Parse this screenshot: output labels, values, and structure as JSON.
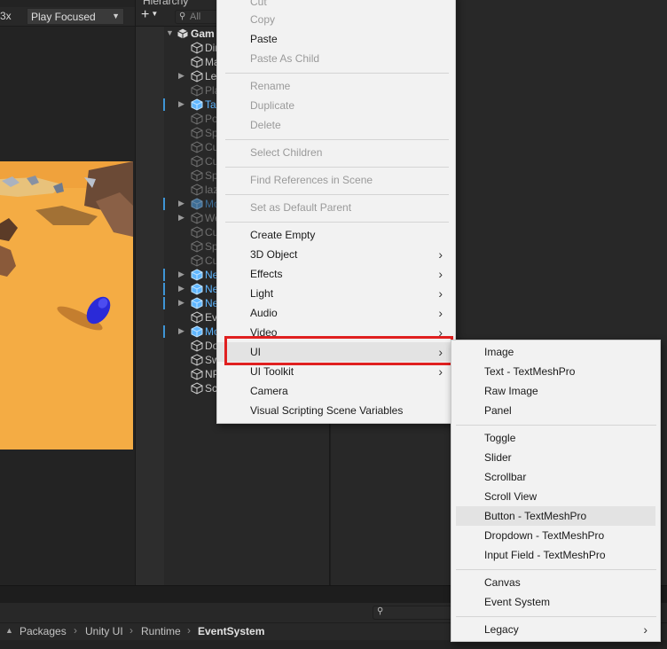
{
  "game_toolbar": {
    "scale": "3x",
    "play_mode": "Play Focused"
  },
  "hierarchy": {
    "tab": "Hierarchy",
    "search_placeholder": "All",
    "root": "Gam",
    "items": [
      {
        "name": "Dir",
        "style": "normal"
      },
      {
        "name": "Ma",
        "style": "normal"
      },
      {
        "name": "Le",
        "style": "normal"
      },
      {
        "name": "Pla",
        "style": "dim"
      },
      {
        "name": "Ta",
        "style": "prefab"
      },
      {
        "name": "Po",
        "style": "dim"
      },
      {
        "name": "Sp",
        "style": "dim"
      },
      {
        "name": "Cu",
        "style": "dim"
      },
      {
        "name": "Cu",
        "style": "dim"
      },
      {
        "name": "Sp",
        "style": "dim"
      },
      {
        "name": "laz",
        "style": "dim"
      },
      {
        "name": "Mo",
        "style": "prefab-dim"
      },
      {
        "name": "We",
        "style": "dim"
      },
      {
        "name": "Cu",
        "style": "dim"
      },
      {
        "name": "Sp",
        "style": "dim"
      },
      {
        "name": "Cu",
        "style": "dim"
      },
      {
        "name": "Ne",
        "style": "prefab"
      },
      {
        "name": "Ne",
        "style": "prefab"
      },
      {
        "name": "Ne",
        "style": "prefab"
      },
      {
        "name": "Eve",
        "style": "normal"
      },
      {
        "name": "Mo",
        "style": "prefab"
      },
      {
        "name": "Do",
        "style": "normal"
      },
      {
        "name": "Sw",
        "style": "normal"
      },
      {
        "name": "NP",
        "style": "normal"
      },
      {
        "name": "Sc",
        "style": "normal"
      }
    ]
  },
  "context_menu": {
    "items": [
      {
        "label": "Cut",
        "disabled": true
      },
      {
        "label": "Copy",
        "disabled": true
      },
      {
        "label": "Paste",
        "disabled": false
      },
      {
        "label": "Paste As Child",
        "disabled": true
      },
      {
        "label": "Rename",
        "disabled": true
      },
      {
        "label": "Duplicate",
        "disabled": true
      },
      {
        "label": "Delete",
        "disabled": true
      },
      {
        "label": "Select Children",
        "disabled": true
      },
      {
        "label": "Find References in Scene",
        "disabled": true
      },
      {
        "label": "Set as Default Parent",
        "disabled": true
      },
      {
        "label": "Create Empty",
        "disabled": false
      },
      {
        "label": "3D Object",
        "disabled": false
      },
      {
        "label": "Effects",
        "disabled": false
      },
      {
        "label": "Light",
        "disabled": false
      },
      {
        "label": "Audio",
        "disabled": false
      },
      {
        "label": "Video",
        "disabled": false
      },
      {
        "label": "UI",
        "disabled": false
      },
      {
        "label": "UI Toolkit",
        "disabled": false
      },
      {
        "label": "Camera",
        "disabled": false
      },
      {
        "label": "Visual Scripting Scene Variables",
        "disabled": false
      }
    ]
  },
  "ui_submenu": {
    "items": [
      {
        "label": "Image"
      },
      {
        "label": "Text - TextMeshPro"
      },
      {
        "label": "Raw Image"
      },
      {
        "label": "Panel"
      },
      {
        "label": "Toggle"
      },
      {
        "label": "Slider"
      },
      {
        "label": "Scrollbar"
      },
      {
        "label": "Scroll View"
      },
      {
        "label": "Button - TextMeshPro"
      },
      {
        "label": "Dropdown - TextMeshPro"
      },
      {
        "label": "Input Field - TextMeshPro"
      },
      {
        "label": "Canvas"
      },
      {
        "label": "Event System"
      },
      {
        "label": "Legacy"
      }
    ]
  },
  "breadcrumb": [
    "Packages",
    "Unity UI",
    "Runtime",
    "EventSystem"
  ],
  "colors": {
    "highlight_box": "#e02020",
    "prefab_blue": "#5fb6ff",
    "game_sand": "#f4ac44",
    "menu_bg": "#f2f2f2"
  }
}
